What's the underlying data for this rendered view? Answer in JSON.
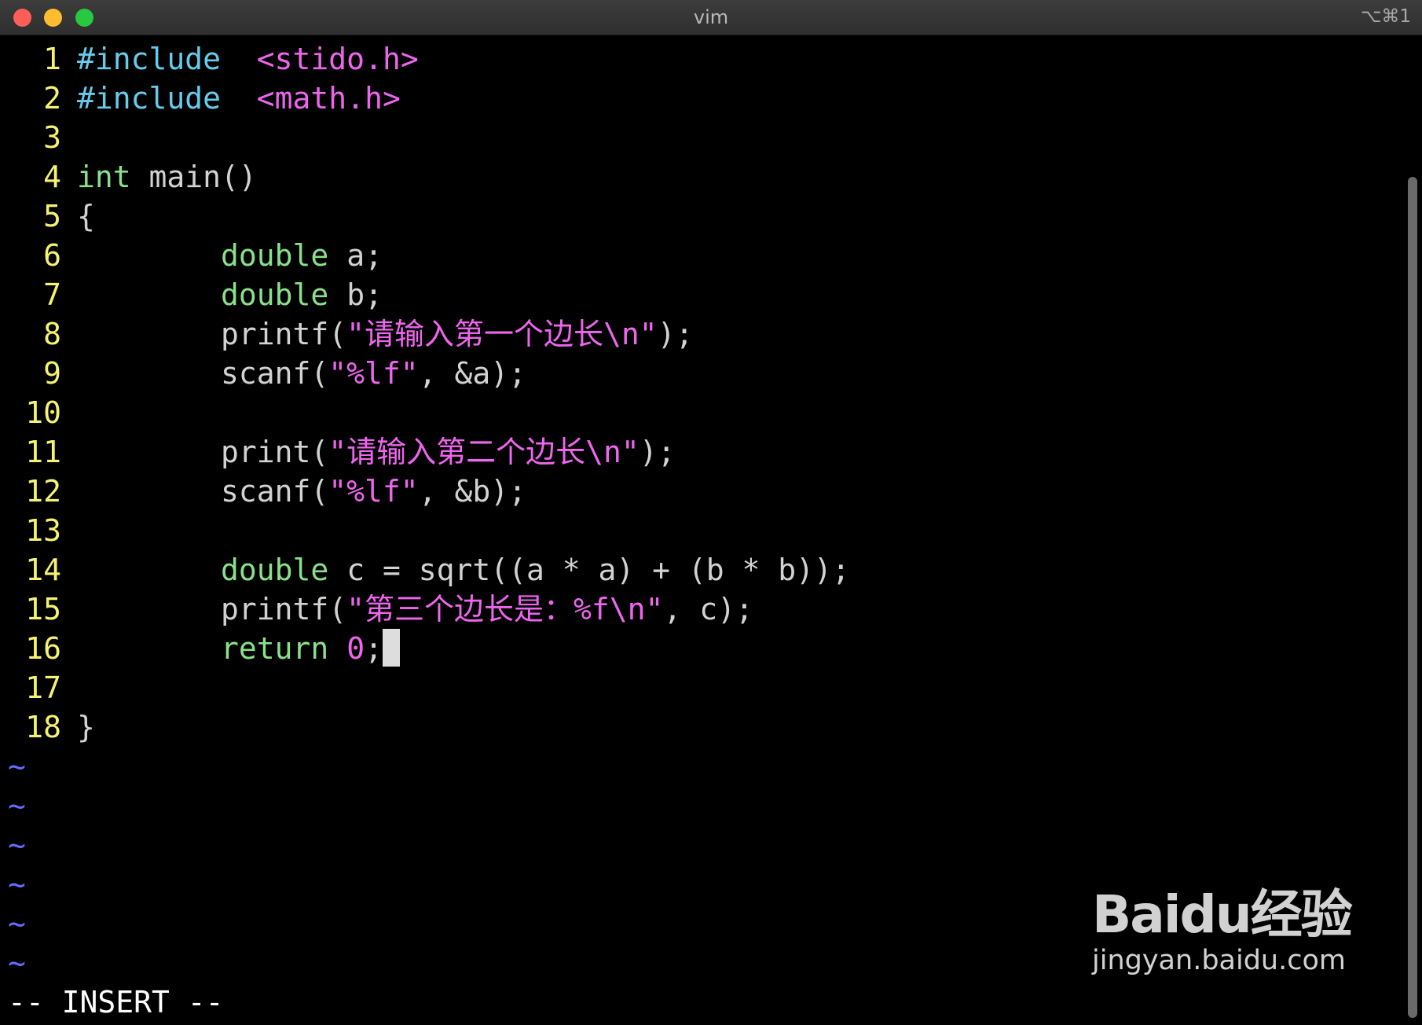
{
  "window": {
    "title": "vim",
    "shortcut": "⌥⌘1"
  },
  "editor": {
    "lines": [
      {
        "n": "1",
        "parts": [
          [
            "pre",
            "#include"
          ],
          [
            "",
            "  "
          ],
          [
            "s",
            "<stido.h>"
          ]
        ]
      },
      {
        "n": "2",
        "parts": [
          [
            "pre",
            "#include"
          ],
          [
            "",
            "  "
          ],
          [
            "s",
            "<math.h>"
          ]
        ]
      },
      {
        "n": "3",
        "parts": []
      },
      {
        "n": "4",
        "parts": [
          [
            "k",
            "int"
          ],
          [
            "",
            " main()"
          ]
        ]
      },
      {
        "n": "5",
        "parts": [
          [
            "",
            "{"
          ]
        ]
      },
      {
        "n": "6",
        "parts": [
          [
            "",
            "        "
          ],
          [
            "k",
            "double"
          ],
          [
            "",
            " a;"
          ]
        ]
      },
      {
        "n": "7",
        "parts": [
          [
            "",
            "        "
          ],
          [
            "k",
            "double"
          ],
          [
            "",
            " b;"
          ]
        ]
      },
      {
        "n": "8",
        "parts": [
          [
            "",
            "        printf("
          ],
          [
            "s",
            "\"请输入第一个边长\\n\""
          ],
          [
            "",
            ");"
          ]
        ]
      },
      {
        "n": "9",
        "parts": [
          [
            "",
            "        scanf("
          ],
          [
            "s",
            "\"%lf\""
          ],
          [
            "",
            ", &a);"
          ]
        ]
      },
      {
        "n": "10",
        "parts": []
      },
      {
        "n": "11",
        "parts": [
          [
            "",
            "        print("
          ],
          [
            "s",
            "\"请输入第二个边长\\n\""
          ],
          [
            "",
            ");"
          ]
        ]
      },
      {
        "n": "12",
        "parts": [
          [
            "",
            "        scanf("
          ],
          [
            "s",
            "\"%lf\""
          ],
          [
            "",
            ", &b);"
          ]
        ]
      },
      {
        "n": "13",
        "parts": []
      },
      {
        "n": "14",
        "parts": [
          [
            "",
            "        "
          ],
          [
            "k",
            "double"
          ],
          [
            "",
            " c = sqrt((a * a) + (b * b));"
          ]
        ]
      },
      {
        "n": "15",
        "parts": [
          [
            "",
            "        printf("
          ],
          [
            "s",
            "\"第三个边长是：%f\\n\""
          ],
          [
            "",
            ", c);"
          ]
        ]
      },
      {
        "n": "16",
        "parts": [
          [
            "",
            "        "
          ],
          [
            "k",
            "return"
          ],
          [
            "",
            " "
          ],
          [
            "s",
            "0"
          ],
          [
            "",
            ";"
          ]
        ]
      },
      {
        "n": "17",
        "parts": []
      },
      {
        "n": "18",
        "parts": [
          [
            "",
            "}"
          ]
        ]
      }
    ],
    "cursor_line": "16",
    "tilde_rows": [
      "~",
      "~",
      "~",
      "~",
      "~",
      "~"
    ]
  },
  "status": {
    "mode": "-- INSERT --"
  },
  "watermark": {
    "logo": "Baidu经验",
    "url": "jingyan.baidu.com"
  },
  "colors": {
    "background": "#000000",
    "line_number": "#f6f370",
    "keyword": "#8be08b",
    "preprocessor": "#66ccee",
    "string": "#ee66ee",
    "tilde": "#6a6aff"
  }
}
